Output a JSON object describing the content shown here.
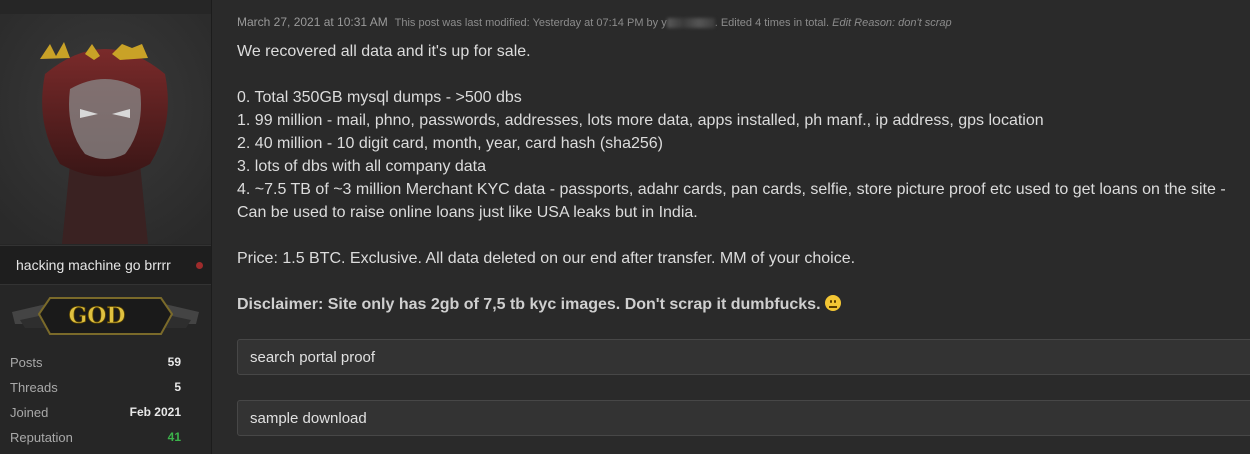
{
  "user": {
    "username": "hacking machine go brrrr",
    "rank_label": "GOD",
    "stats": [
      {
        "label": "Posts",
        "value": "59",
        "color": "#e8e8e8"
      },
      {
        "label": "Threads",
        "value": "5",
        "color": "#e8e8e8"
      },
      {
        "label": "Joined",
        "value": "Feb 2021",
        "color": "#e8e8e8"
      },
      {
        "label": "Reputation",
        "value": "41",
        "color": "#3bb34a"
      }
    ],
    "status_color": "#9e2b2b"
  },
  "post": {
    "date": "March 27, 2021 at 10:31 AM",
    "modified_prefix": "This post was last modified: Yesterday at 07:14 PM by y",
    "modified_suffix": ". Edited 4 times in total.",
    "edit_reason": "Edit Reason: don't scrap",
    "lines": [
      "We recovered all data and it's up for sale.",
      "",
      "0. Total 350GB mysql dumps - >500 dbs",
      "1. 99 million - mail, phno, passwords, addresses, lots more data, apps installed, ph manf., ip address, gps location",
      "2. 40 million - 10 digit card, month, year, card hash (sha256)",
      "3. lots of dbs with all company data",
      "4. ~7.5 TB of ~3 million Merchant KYC data - passports, adahr cards, pan cards, selfie, store picture proof etc used to get loans on the site -",
      "Can be used to raise online loans just like USA leaks but in India.",
      "",
      "Price: 1.5 BTC. Exclusive. All data deleted on our end after transfer. MM of your choice.",
      ""
    ],
    "disclaimer": "Disclaimer: Site only has 2gb of 7,5 tb kyc images. Don't scrap it dumbfucks.",
    "emoji": "neutral-face-emoji",
    "spoilers": [
      {
        "label": "search portal proof"
      },
      {
        "label": "sample download"
      }
    ]
  }
}
